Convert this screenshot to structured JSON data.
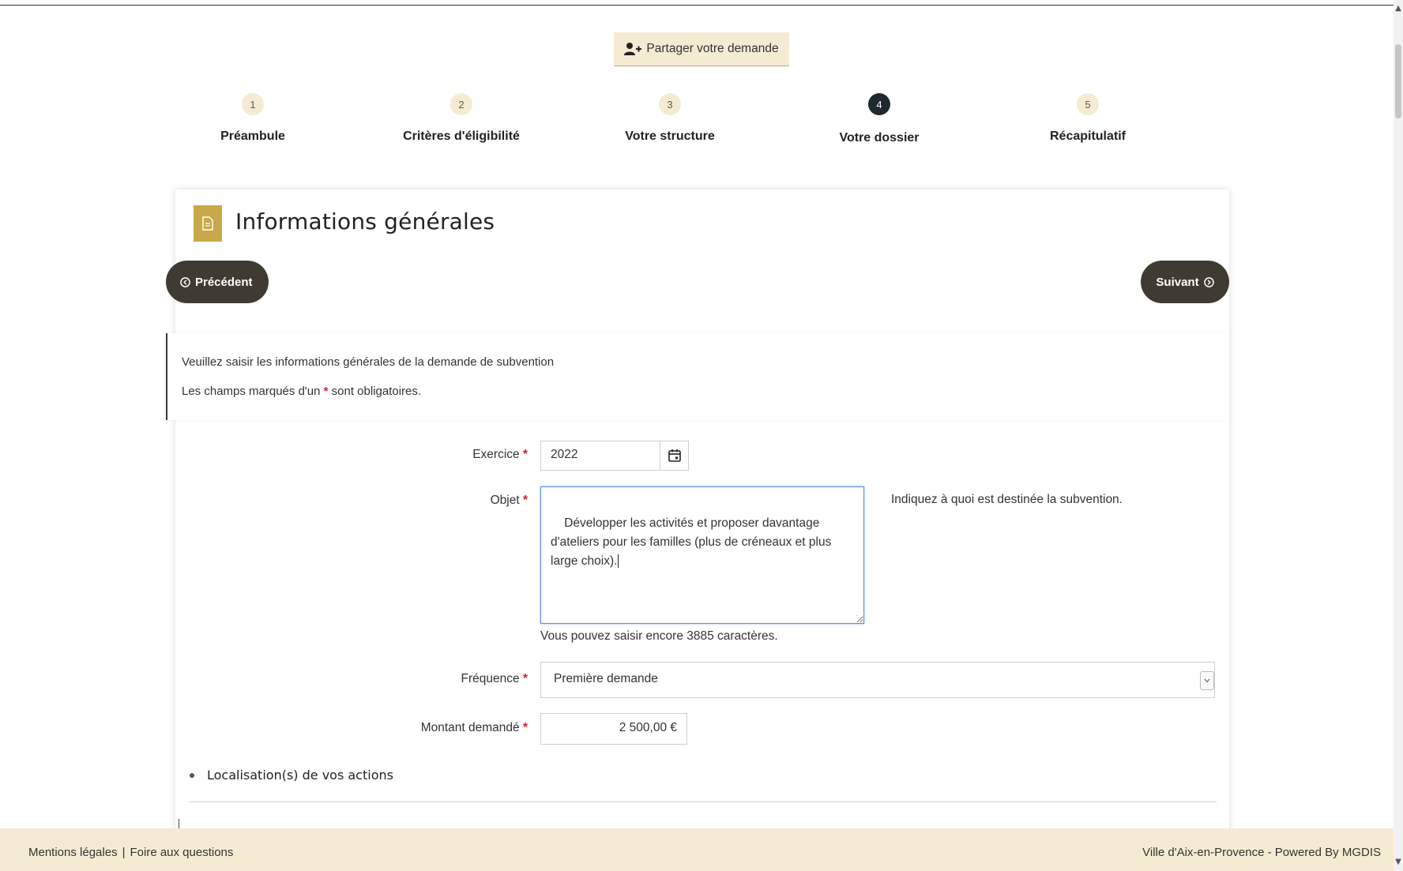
{
  "share_button": {
    "label": "Partager votre demande",
    "icon": "user-plus-icon"
  },
  "steps": [
    {
      "number": "1",
      "label": "Préambule",
      "active": false
    },
    {
      "number": "2",
      "label": "Critères d'éligibilité",
      "active": false
    },
    {
      "number": "3",
      "label": "Votre structure",
      "active": false
    },
    {
      "number": "4",
      "label": "Votre dossier",
      "active": true
    },
    {
      "number": "5",
      "label": "Récapitulatif",
      "active": false
    }
  ],
  "card": {
    "title": "Informations générales",
    "icon": "document-icon",
    "prev_label": "Précédent",
    "next_label": "Suivant"
  },
  "info": {
    "line1": "Veuillez saisir les informations générales de la demande de subvention",
    "line2_before": "Les champs marqués d'un ",
    "line2_star": "*",
    "line2_after": " sont obligatoires."
  },
  "form": {
    "exercice": {
      "label": "Exercice",
      "required": "*",
      "value": "2022"
    },
    "objet": {
      "label": "Objet",
      "required": "*",
      "value": "Développer les activités et proposer davantage d'ateliers pour les familles (plus de créneaux et plus large choix).",
      "hint": "Indiquez à quoi est destinée la subvention.",
      "char_count": "Vous pouvez saisir encore 3885 caractères."
    },
    "frequence": {
      "label": "Fréquence",
      "required": "*",
      "value": "Première demande"
    },
    "montant": {
      "label": "Montant demandé",
      "required": "*",
      "value": "2 500,00 €"
    }
  },
  "section": {
    "title": "Localisation(s) de vos actions"
  },
  "footer": {
    "mentions": "Mentions légales",
    "separator": "|",
    "faq": "Foire aux questions",
    "right": "Ville d'Aix-en-Provence - Powered By MGDIS"
  },
  "colors": {
    "accent_beige": "#f5ebd3",
    "dark_button": "#3f3b33",
    "active_step": "#1e2a30",
    "gold_icon": "#c9a84c",
    "required_star": "#d1202f"
  }
}
